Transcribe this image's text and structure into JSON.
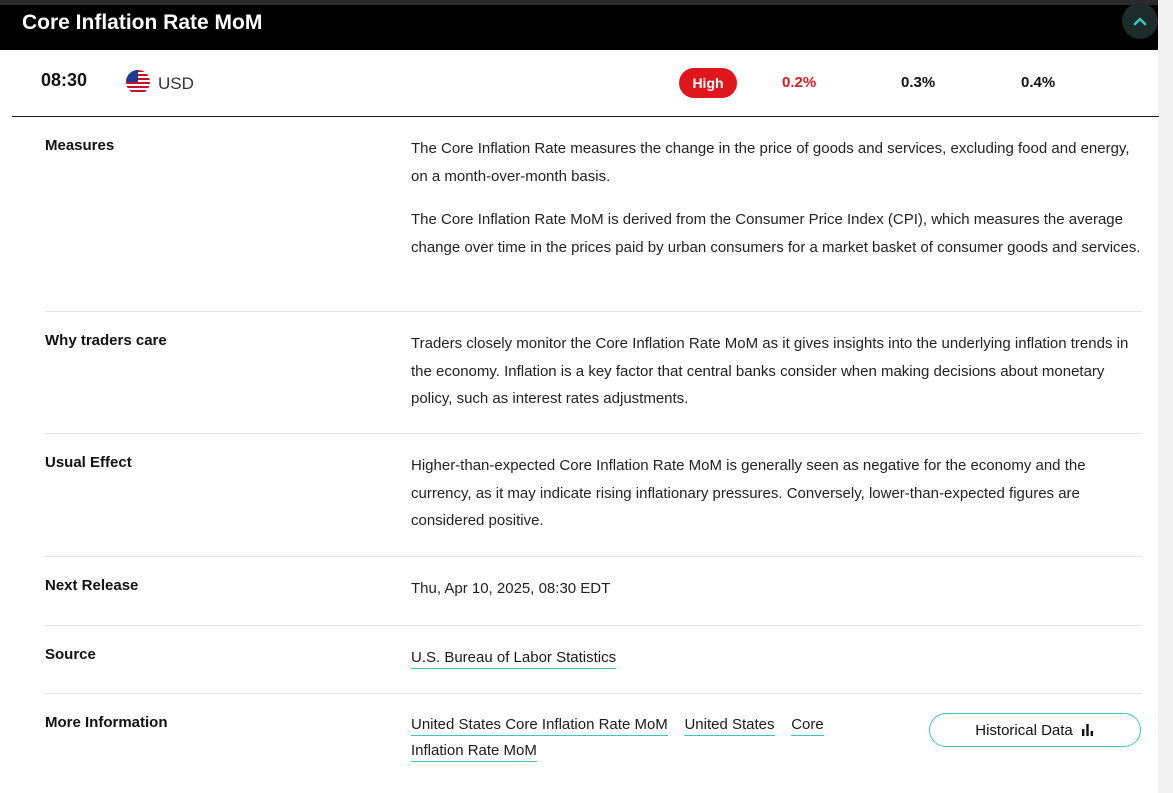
{
  "header": {
    "title": "Core Inflation Rate MoM"
  },
  "event": {
    "time": "08:30",
    "currency": "USD",
    "flag_icon": "us-flag-icon",
    "impact": "High",
    "impact_color": "#e0161d",
    "actual": "0.2%",
    "actual_color": "#e0161d",
    "forecast": "0.3%",
    "previous": "0.4%"
  },
  "details": {
    "measures": {
      "label": "Measures",
      "p1": "The Core Inflation Rate measures the change in the price of goods and services, excluding food and energy, on a month-over-month basis.",
      "p2": "The Core Inflation Rate MoM is derived from the Consumer Price Index (CPI), which measures the average change over time in the prices paid by urban consumers for a market basket of consumer goods and services."
    },
    "why": {
      "label": "Why traders care",
      "text": "Traders closely monitor the Core Inflation Rate MoM as it gives insights into the underlying inflation trends in the economy. Inflation is a key factor that central banks consider when making decisions about monetary policy, such as interest rates adjustments."
    },
    "effect": {
      "label": "Usual Effect",
      "text": "Higher-than-expected Core Inflation Rate MoM is generally seen as negative for the economy and the currency, as it may indicate rising inflationary pressures. Conversely, lower-than-expected figures are considered positive."
    },
    "next_release": {
      "label": "Next Release",
      "text": "Thu, Apr 10, 2025, 08:30 EDT"
    },
    "source": {
      "label": "Source",
      "link": "U.S. Bureau of Labor Statistics"
    },
    "more_info": {
      "label": "More Information",
      "links": [
        "United States Core Inflation Rate MoM",
        "United States",
        "Core",
        "Inflation Rate MoM"
      ],
      "button": "Historical Data",
      "button_icon": "bar-chart-icon"
    }
  },
  "colors": {
    "accent": "#39c6c0",
    "header_bg": "#000000"
  }
}
